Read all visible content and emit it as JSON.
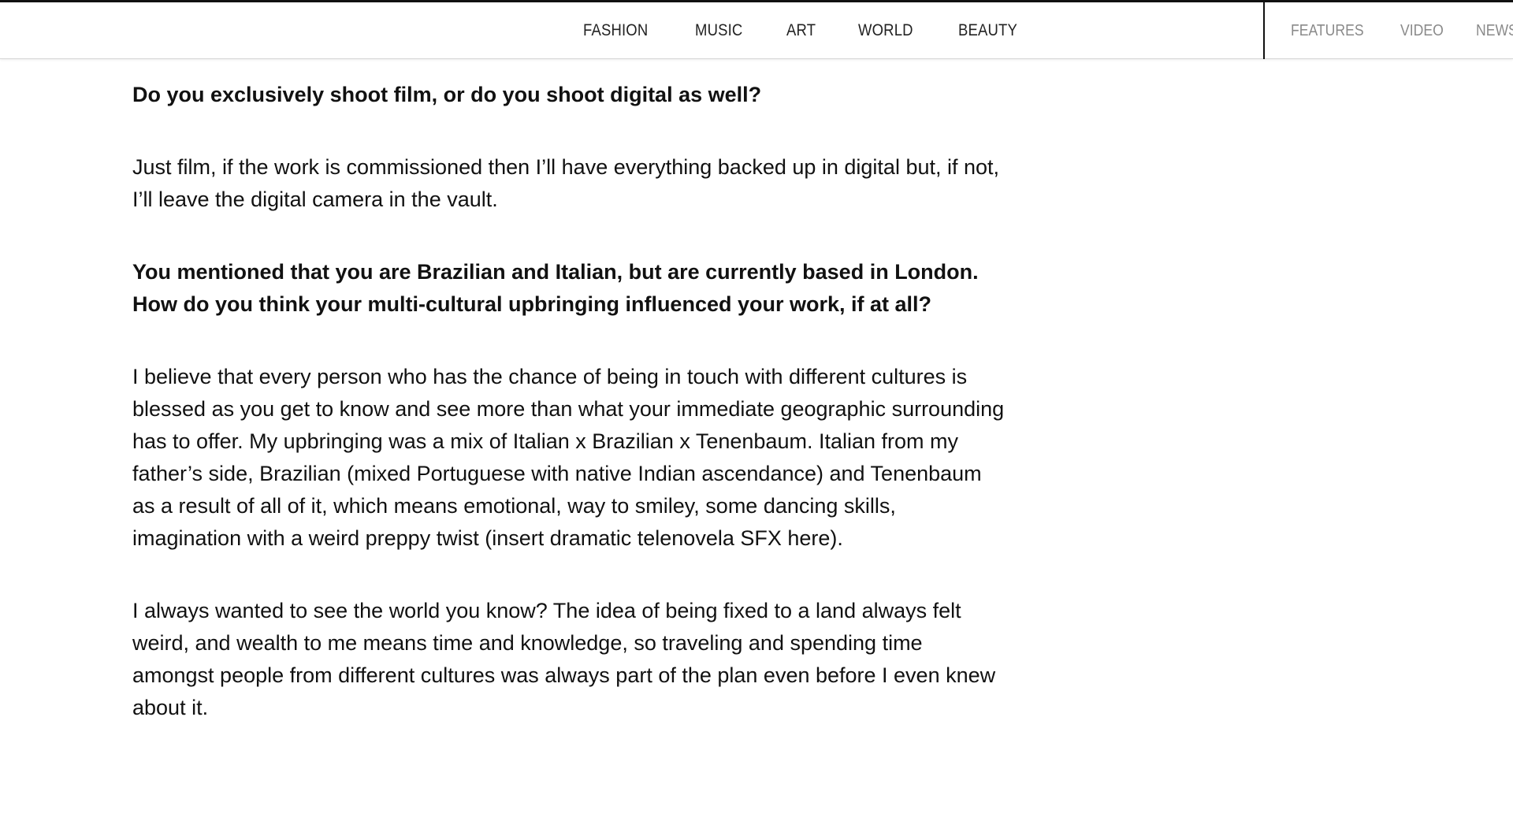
{
  "nav": {
    "main": [
      "FASHION",
      "MUSIC",
      "ART",
      "WORLD",
      "BEAUTY"
    ],
    "secondary": [
      "FEATURES",
      "VIDEO",
      "NEWS"
    ]
  },
  "article": {
    "q1": "Do you exclusively shoot film, or do you shoot digital as well?",
    "a1": "Just film, if the work is commissioned then I’ll have everything backed up in digital but, if not, I’ll leave the digital camera in the vault.",
    "q2": "You mentioned that you are Brazilian and Italian, but are currently based in London. How do you think your multi-cultural upbringing influenced your work, if at all?",
    "a2": "I believe that every person who has the chance of being in touch with different cultures is blessed as you get to know and see more than what your immediate geographic surrounding has to offer. My upbringing was a mix of Italian x Brazilian x Tenenbaum. Italian from my father’s side, Brazilian (mixed Portuguese with native Indian ascendance) and Tenenbaum as a result of all of it, which means emotional, way to smiley, some dancing skills, imagination with a weird preppy twist (insert dramatic telenovela SFX here).",
    "a3": "I always wanted to see the world you know? The idea of being fixed to a land always felt weird, and wealth to me means time and knowledge, so traveling and spending time amongst people from different cultures was always part of the plan even before I even knew about it."
  }
}
